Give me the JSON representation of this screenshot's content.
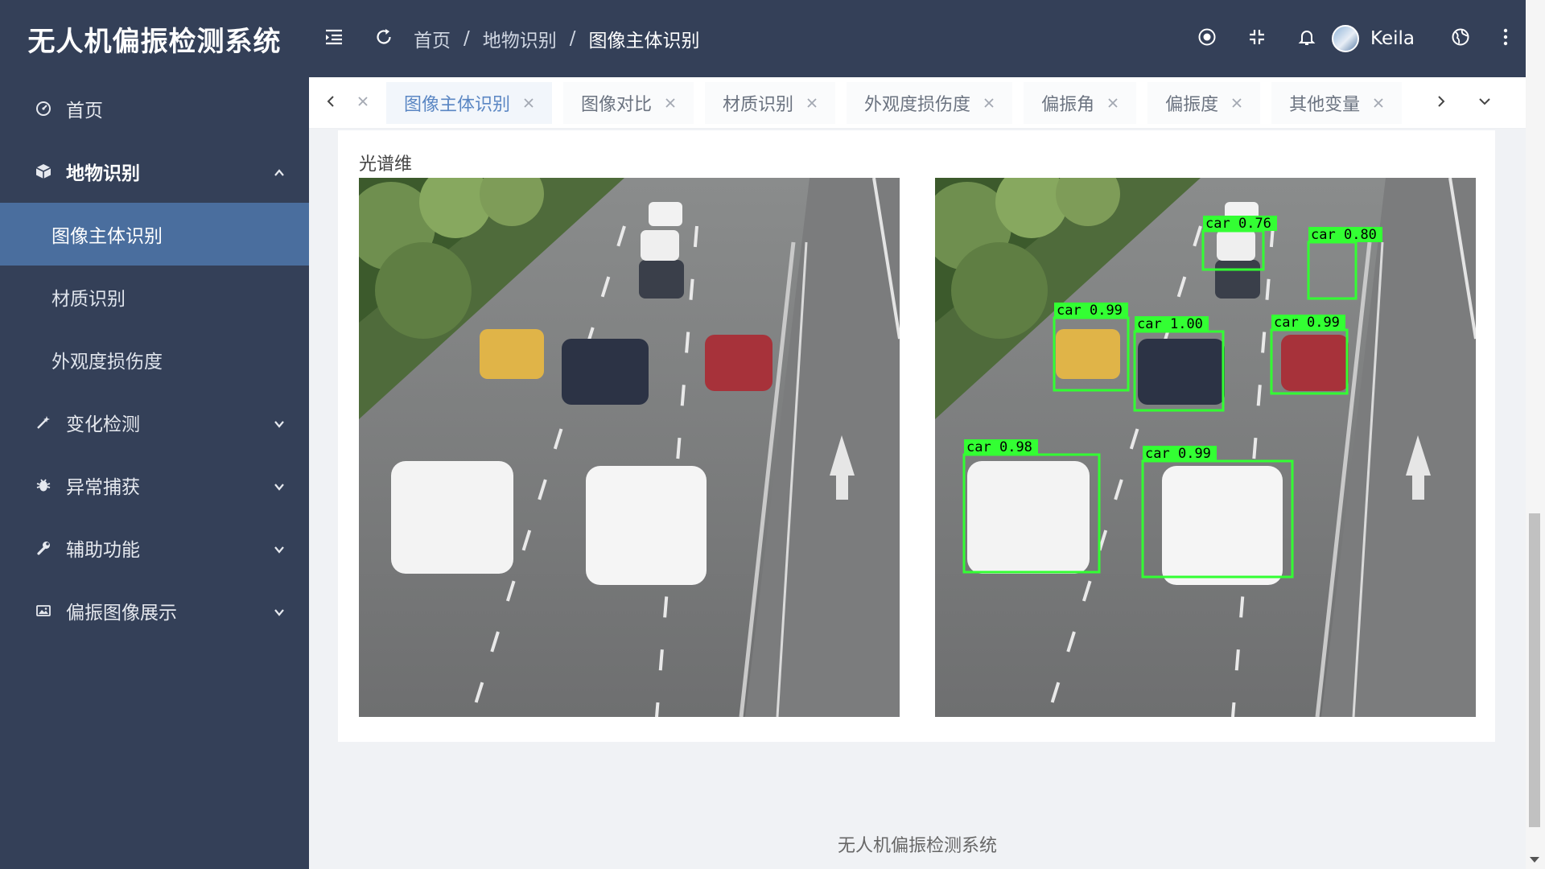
{
  "app": {
    "title": "无人机偏振检测系统"
  },
  "sidebar": {
    "items": [
      {
        "label": "首页",
        "icon": "dashboard-icon"
      },
      {
        "label": "地物识别",
        "icon": "cube-icon",
        "expanded": true,
        "children": [
          {
            "label": "图像主体识别",
            "active": true
          },
          {
            "label": "材质识别"
          },
          {
            "label": "外观度损伤度"
          }
        ]
      },
      {
        "label": "变化检测",
        "icon": "magic-wand-icon"
      },
      {
        "label": "异常捕获",
        "icon": "bug-icon"
      },
      {
        "label": "辅助功能",
        "icon": "wrench-icon"
      },
      {
        "label": "偏振图像展示",
        "icon": "picture-icon"
      }
    ]
  },
  "header": {
    "breadcrumb": [
      "首页",
      "地物识别",
      "图像主体识别"
    ],
    "separator": "/",
    "username": "Keila"
  },
  "tabs": [
    "图像主体识别",
    "图像对比",
    "材质识别",
    "外观度损伤度",
    "偏振角",
    "偏振度",
    "其他变量"
  ],
  "active_tab": "图像主体识别",
  "main": {
    "section_title": "光谱维",
    "detections": [
      {
        "label": "car",
        "score": "0.99"
      },
      {
        "label": "car",
        "score": "1.00"
      },
      {
        "label": "car",
        "score": "0.99"
      },
      {
        "label": "car",
        "score": "0.76"
      },
      {
        "label": "car",
        "score": "0.80"
      },
      {
        "label": "car",
        "score": "0.98"
      },
      {
        "label": "car",
        "score": "0.99"
      }
    ],
    "box_color": "#33ff33"
  },
  "footer": {
    "text": "无人机偏振检测系统"
  },
  "colors": {
    "sidebar_bg": "#344058",
    "active_item_bg": "#4a6e9e",
    "accent": "#5a86c3"
  }
}
